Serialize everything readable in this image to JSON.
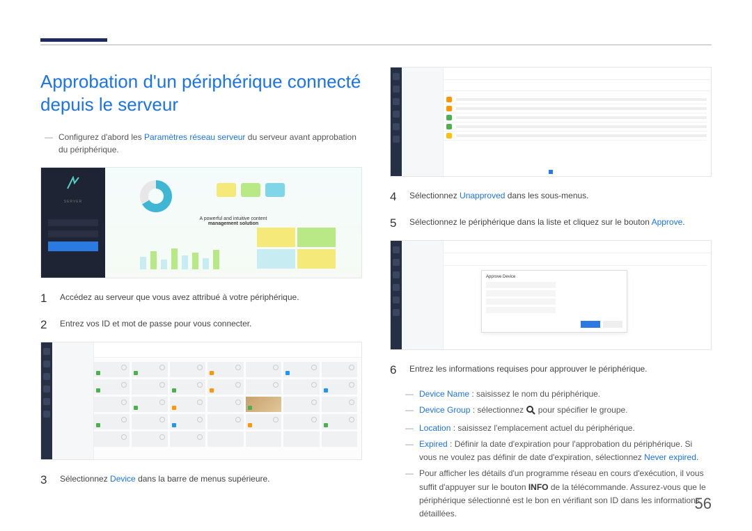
{
  "page_number": "56",
  "title": "Approbation d'un périphérique connecté depuis le serveur",
  "intro_prefix": "Configurez d'abord les ",
  "intro_link": "Paramètres réseau serveur",
  "intro_suffix": " du serveur avant approbation du périphérique.",
  "fig1_caption1": "A powerful and intuitive content",
  "fig1_caption2": "management solution",
  "step1": "Accédez au serveur que vous avez attribué à votre périphérique.",
  "step2": "Entrez vos ID et mot de passe pour vous connecter.",
  "step3_a": "Sélectionnez ",
  "step3_link": "Device",
  "step3_b": " dans la barre de menus supérieure.",
  "step4_a": "Sélectionnez ",
  "step4_link": "Unapproved",
  "step4_b": " dans les sous-menus.",
  "step5_a": "Sélectionnez le périphérique dans la liste et cliquez sur le bouton ",
  "step5_link": "Approve",
  "step5_b": ".",
  "step6": "Entrez les informations requises pour approuver le périphérique.",
  "sub1_label": "Device Name",
  "sub1_text": " : saisissez le nom du périphérique.",
  "sub2_label": "Device Group",
  "sub2_text_a": " : sélectionnez ",
  "sub2_text_b": " pour spécifier le groupe.",
  "sub3_label": "Location",
  "sub3_text": " : saisissez l'emplacement actuel du périphérique.",
  "sub4_label": "Expired",
  "sub4_text_a": " : Définir la date d'expiration pour l'approbation du périphérique. Si vous ne voulez pas définir de date d'expiration, sélectionnez ",
  "sub4_link": "Never expired",
  "sub4_text_b": ".",
  "note_a": "Pour afficher les détails d'un programme réseau en cours d'exécution, il vous suffit d'appuyer sur le bouton ",
  "note_bold": "INFO",
  "note_b": " de la télécommande. Assurez-vous que le périphérique sélectionné est le bon en vérifiant son ID dans les informations détaillées."
}
